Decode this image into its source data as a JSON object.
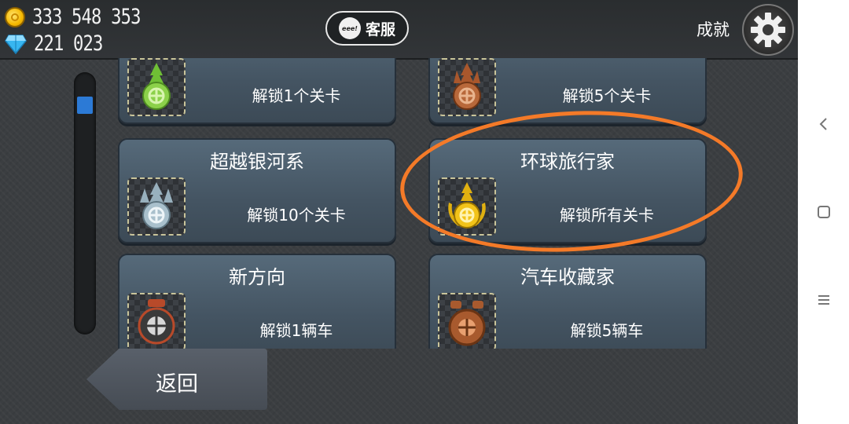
{
  "currency": {
    "coins": "333 548 353",
    "gems": "221 023"
  },
  "header": {
    "service_label": "客服",
    "service_icon_text": "eee!",
    "achievements_label": "成就"
  },
  "achievements": [
    {
      "title": "",
      "description": "解锁1个关卡",
      "badge": "green-tree-badge-icon",
      "color": "#8cd14a"
    },
    {
      "title": "",
      "description": "解锁5个关卡",
      "badge": "bronze-tree-badge-icon",
      "color": "#b8683a"
    },
    {
      "title": "超越银河系",
      "description": "解锁10个关卡",
      "badge": "silver-tree-badge-icon",
      "color": "#a9c0cc"
    },
    {
      "title": "环球旅行家",
      "description": "解锁所有关卡",
      "badge": "gold-laurel-badge-icon",
      "color": "#f2c319"
    },
    {
      "title": "新方向",
      "description": "解锁1辆车",
      "badge": "dark-wheel-badge-icon",
      "color": "#3a3a3a"
    },
    {
      "title": "汽车收藏家",
      "description": "解锁5辆车",
      "badge": "bronze-wheel-badge-icon",
      "color": "#a85a2e"
    }
  ],
  "scroll": {
    "position": 0.1
  },
  "back_label": "返回",
  "colors": {
    "highlight": "#f47a28",
    "scroll_thumb": "#2c7ad6"
  }
}
